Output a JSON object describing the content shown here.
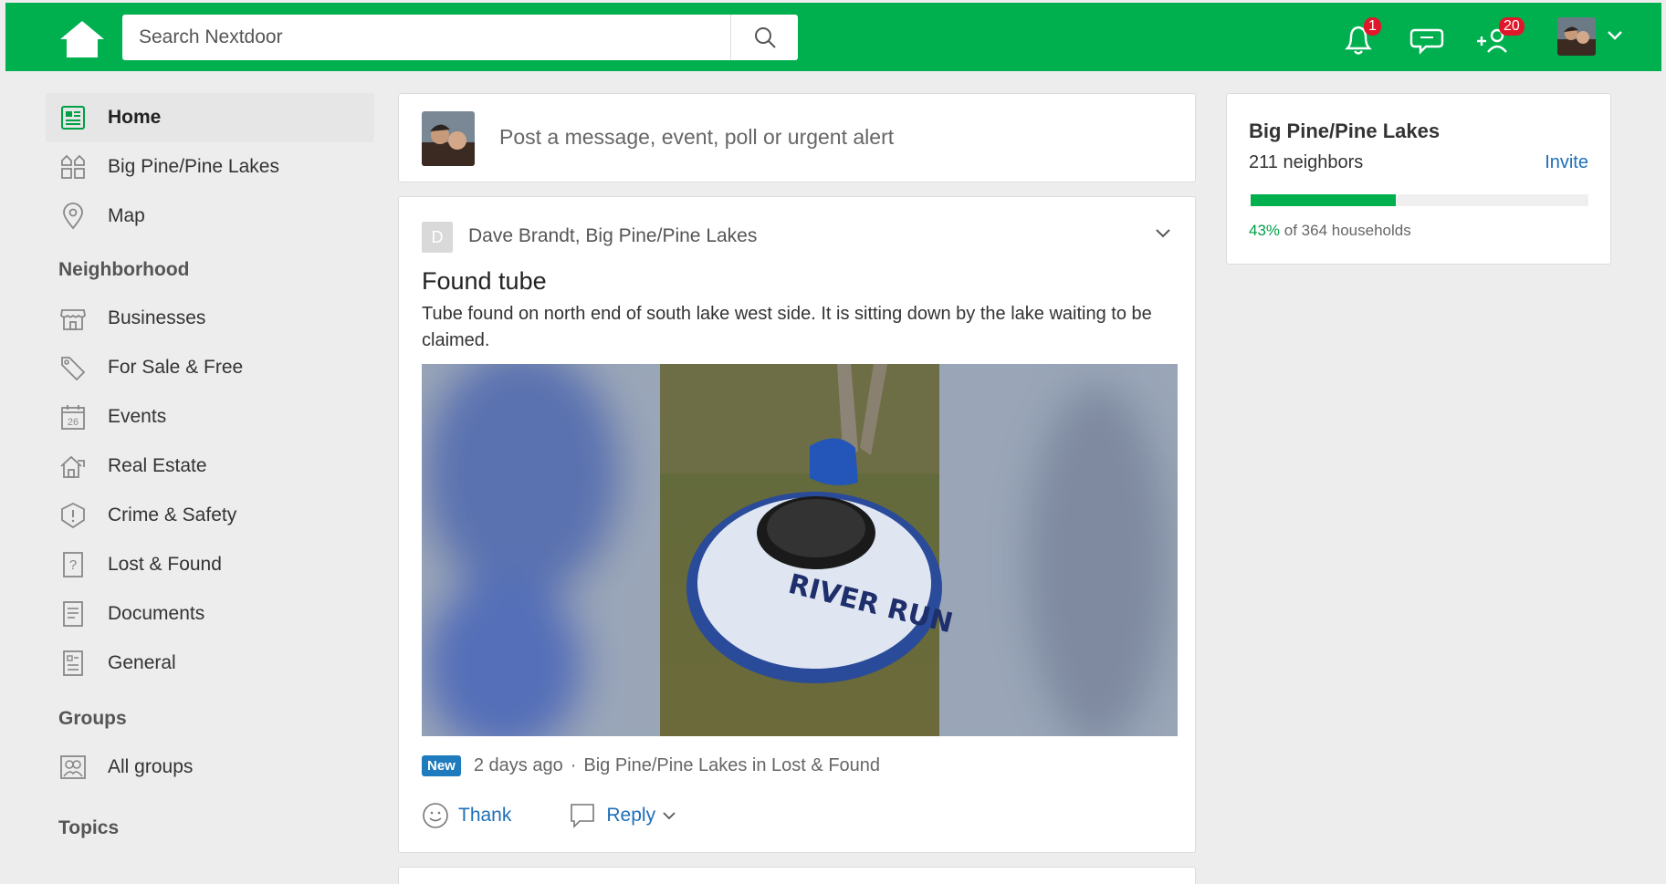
{
  "topbar": {
    "search_placeholder": "Search Nextdoor",
    "notifications_count": "1",
    "neighbors_count": "20"
  },
  "sidebar": {
    "items": [
      {
        "label": "Home",
        "icon": "newsfeed-icon"
      },
      {
        "label": "Big Pine/Pine Lakes",
        "icon": "neighborhood-icon"
      },
      {
        "label": "Map",
        "icon": "map-pin-icon"
      }
    ],
    "neighborhood_heading": "Neighborhood",
    "neighborhood_items": [
      {
        "label": "Businesses",
        "icon": "storefront-icon"
      },
      {
        "label": "For Sale & Free",
        "icon": "price-tag-icon"
      },
      {
        "label": "Events",
        "icon": "calendar-icon"
      },
      {
        "label": "Real Estate",
        "icon": "house-icon"
      },
      {
        "label": "Crime & Safety",
        "icon": "alert-icon"
      },
      {
        "label": "Lost & Found",
        "icon": "question-icon"
      },
      {
        "label": "Documents",
        "icon": "document-icon"
      },
      {
        "label": "General",
        "icon": "general-icon"
      }
    ],
    "groups_heading": "Groups",
    "groups_items": [
      {
        "label": "All groups",
        "icon": "groups-icon"
      }
    ],
    "topics_heading": "Topics",
    "calendar_day": "26"
  },
  "composer": {
    "placeholder": "Post a message, event, poll or urgent alert"
  },
  "post": {
    "author_initial": "D",
    "author": "Dave Brandt, Big Pine/Pine Lakes",
    "title": "Found tube",
    "body": "Tube found on north end of south lake west side. It is sitting down by the lake waiting to be claimed.",
    "photo_text": "RIVER RUN",
    "badge": "New",
    "time": "2 days ago",
    "separator": "·",
    "location": "Big Pine/Pine Lakes in Lost & Found",
    "thank_label": "Thank",
    "reply_label": "Reply"
  },
  "neighborhood_card": {
    "name": "Big Pine/Pine Lakes",
    "neighbors": "211 neighbors",
    "invite_label": "Invite",
    "percent_label": "43%",
    "households_label": "of 364 households",
    "progress_fraction": 0.43
  },
  "colors": {
    "brand_green": "#00b04f",
    "link_blue": "#1e6fb8",
    "badge_red": "#e0172a",
    "new_badge_blue": "#1e7bbd"
  }
}
